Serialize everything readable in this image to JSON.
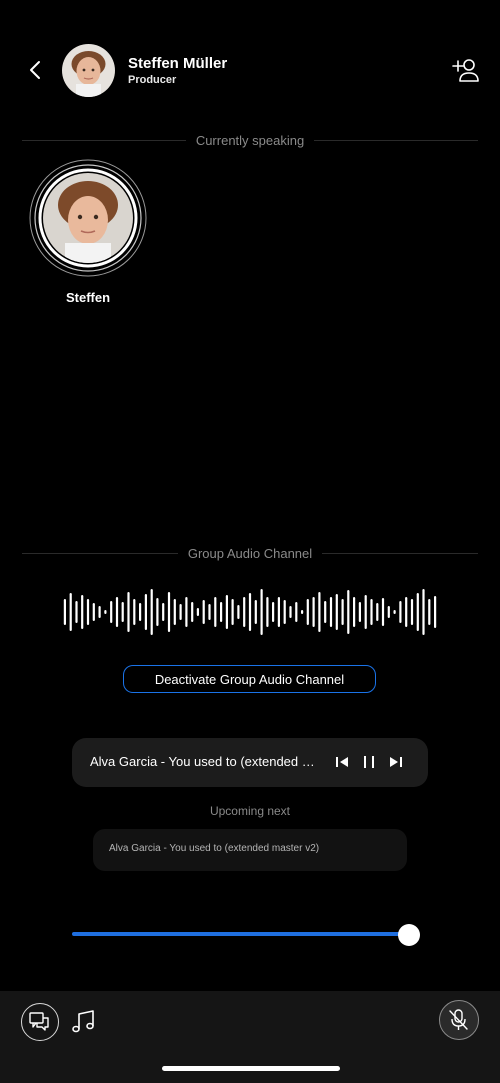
{
  "header": {
    "name": "Steffen Müller",
    "role": "Producer",
    "back_icon": "chevron-left-icon",
    "add_user_icon": "add-user-icon"
  },
  "currently_speaking": {
    "label": "Currently speaking",
    "speaker_name": "Steffen"
  },
  "audio_channel": {
    "label": "Group Audio Channel",
    "deactivate_label": "Deactivate Group Audio Channel",
    "accent_color": "#1a73e8"
  },
  "now_playing": {
    "title": "Alva Garcia - You used to (extended master v2)",
    "controls": [
      "skip-back-icon",
      "pause-icon",
      "skip-forward-icon"
    ]
  },
  "upcoming": {
    "label": "Upcoming next",
    "title": "Alva Garcia - You used to (extended master v2)"
  },
  "volume": {
    "value_fraction": 0.99
  },
  "bottom_bar": {
    "chat_icon": "chat-icon",
    "music_icon": "music-note-icon",
    "mic_icon": "mic-muted-icon"
  }
}
